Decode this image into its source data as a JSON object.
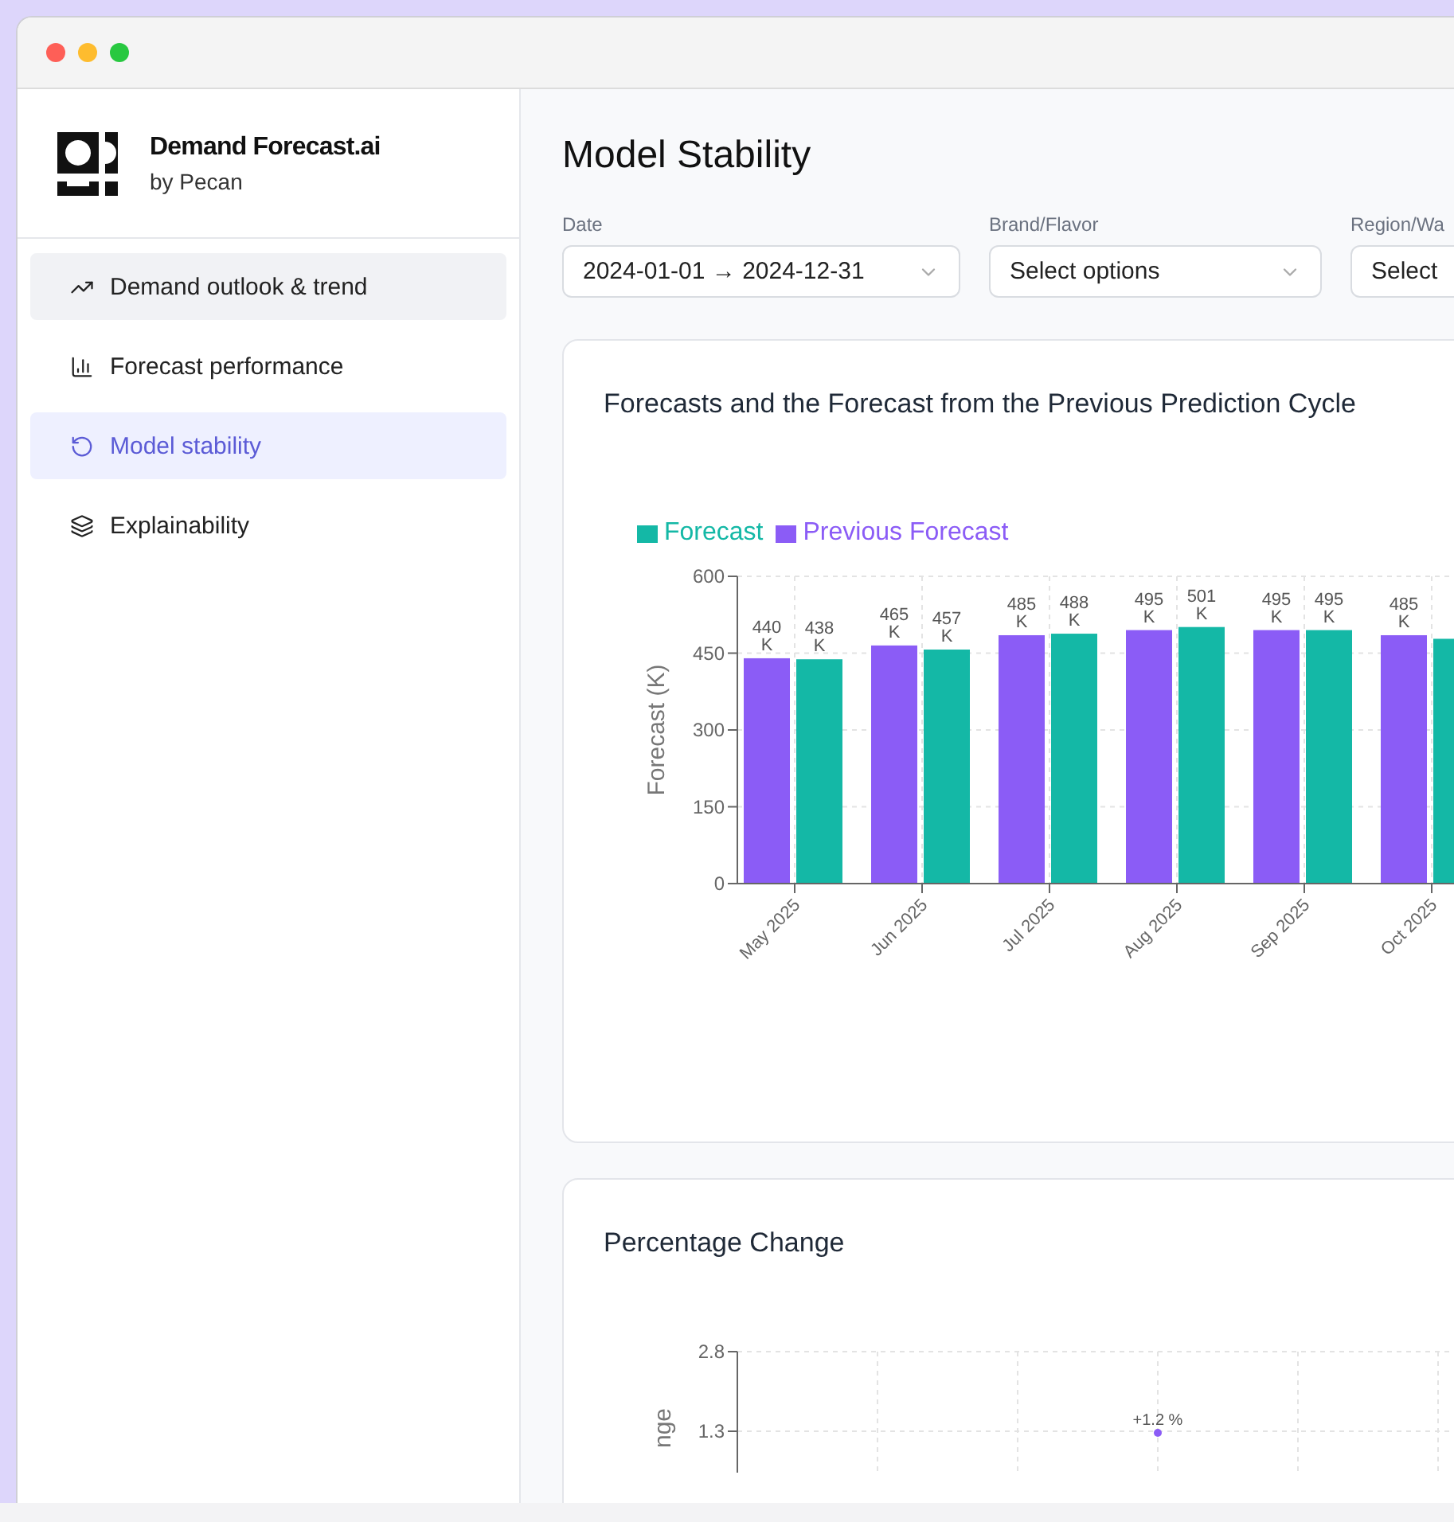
{
  "window": {
    "controls": [
      {
        "kind": "close"
      },
      {
        "kind": "minimize"
      },
      {
        "kind": "zoom"
      }
    ]
  },
  "brand": {
    "name": "Demand Forecast.ai",
    "byline": "by Pecan"
  },
  "sidebar": {
    "items": [
      {
        "label": "Demand outlook & trend",
        "kind": "trend",
        "selected": false,
        "hovered": true
      },
      {
        "label": "Forecast performance",
        "kind": "bars",
        "selected": false,
        "hovered": false
      },
      {
        "label": "Model stability",
        "kind": "rotate",
        "selected": true,
        "hovered": false
      },
      {
        "label": "Explainability",
        "kind": "layers",
        "selected": false,
        "hovered": false
      }
    ]
  },
  "page": {
    "title": "Model Stability"
  },
  "filters": [
    {
      "label": "Date",
      "value": "2024-01-01 → 2024-12-31",
      "chevron": true
    },
    {
      "label": "Brand/Flavor",
      "placeholder": "Select options",
      "chevron": true
    },
    {
      "label": "Region/Wa",
      "placeholder": "Select"
    }
  ],
  "cards": [
    {
      "title": "Forecasts and the Forecast from the Previous Prediction Cycle",
      "chart_data": {
        "type": "bar",
        "ylabel": "Forecast (K)",
        "categories": [
          "May 2025",
          "Jun 2025",
          "Jul 2025",
          "Aug 2025",
          "Sep 2025",
          "Oct 2025"
        ],
        "ylim": [
          0,
          600
        ],
        "yticks": [
          0,
          150,
          300,
          450,
          600
        ],
        "grid": true,
        "series": [
          {
            "name": "Forecast",
            "color": "#14b8a6",
            "values": [
              438,
              457,
              488,
              501,
              495,
              478
            ],
            "value_labels": [
              "438 K",
              "457 K",
              "488 K",
              "501 K",
              "495 K",
              null
            ]
          },
          {
            "name": "Previous Forecast",
            "color": "#8b5cf6",
            "values": [
              440,
              465,
              485,
              495,
              495,
              485
            ],
            "value_labels": [
              "440 K",
              "465 K",
              "485 K",
              "495 K",
              "495 K",
              "485 K"
            ]
          }
        ]
      }
    },
    {
      "title": "Percentage Change",
      "plot": {
        "y_title": "nge",
        "y_ticks": [
          "2.8",
          "1.3"
        ],
        "point_label": "+1.2 %"
      }
    }
  ]
}
